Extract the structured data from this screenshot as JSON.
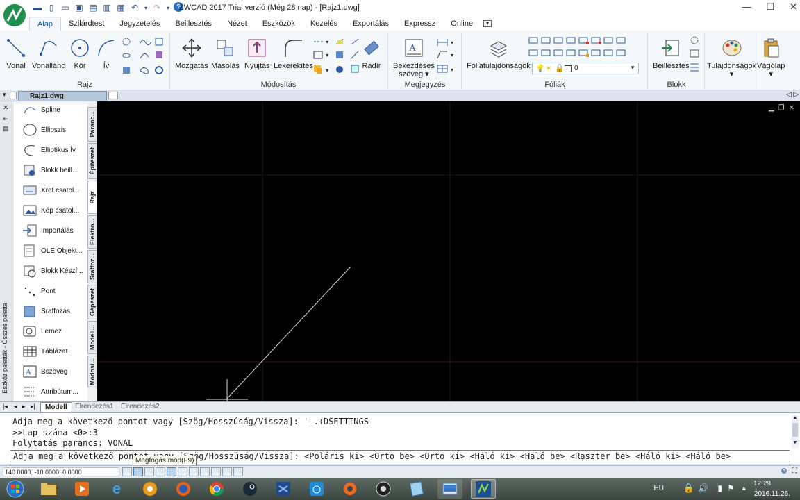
{
  "titlebar": {
    "title": "ZWCAD 2017 Trial verzió  (Még 28 nap) - [Rajz1.dwg]",
    "minimize": "—",
    "maximize": "☐",
    "close": "✕"
  },
  "ribbon_tabs": [
    "Alap",
    "Szilárdtest",
    "Jegyzetelés",
    "Beillesztés",
    "Nézet",
    "Eszközök",
    "Kezelés",
    "Exportálás",
    "Expressz",
    "Online"
  ],
  "ribbon": {
    "draw": {
      "vonal": "Vonal",
      "vonallanc": "Vonallánc",
      "kor": "Kör",
      "iv": "Ív",
      "group": "Rajz"
    },
    "modify": {
      "mozgatas": "Mozgatás",
      "masolas": "Másolás",
      "nyujtas": "Nyújtás",
      "lekerekites": "Lekerekítés",
      "radir": "Radír",
      "group": "Módosítás"
    },
    "annotation": {
      "bekezdeses_line1": "Bekezdéses",
      "bekezdeses_line2": "szöveg",
      "group": "Megjegyzés"
    },
    "layers": {
      "foliatulajdonsagok": "Fóliatulajdonságok",
      "current_layer": "0",
      "group": "Fóliák"
    },
    "block": {
      "beillesztes": "Beillesztés",
      "group": "Blokk"
    },
    "tulajdonsagok": "Tulajdonságok",
    "vagolap": "Vágólap"
  },
  "document_tab": "Rajz1.dwg",
  "palette": {
    "title": "Eszköz paletták - Összes paletta",
    "items": [
      "Spline",
      "Ellipszis",
      "Elliptikus Ív",
      "Blokk beill...",
      "Xref csatol...",
      "Kép csatol...",
      "Importálás",
      "OLE Objekt...",
      "Blokk Készí...",
      "Pont",
      "Sraffozás",
      "Lemez",
      "Táblázat",
      "Bszöveg",
      "Attribútum..."
    ],
    "tabs": [
      "Paranc...",
      "Építészet",
      "Rajz",
      "Elektro...",
      "Sraffoz...",
      "Gépészet",
      "Modell...",
      "Módosí..."
    ]
  },
  "layout_tabs": [
    "Modell",
    "Elrendezés1",
    "Elrendezés2"
  ],
  "command": {
    "history": [
      "Adja meg a következő pontot vagy [Szög/Hosszúság/Vissza]: '_.+DSETTINGS",
      ">>Lap száma <0>:3",
      "Folytatás parancs: VONAL"
    ],
    "current": "Adja meg a következő pontot vagy [Szög/Hosszúság/Vissza]:  <Poláris ki>  <Orto be>  <Orto ki>  <Háló ki>  <Háló be>  <Raszter be>  <Háló ki>  <Háló be>"
  },
  "tooltip": "Megfogás mód(F9)",
  "status": {
    "coords": "140.0000, -10.0000, 0.0000"
  },
  "tray": {
    "lang": "HU",
    "time": "12:29",
    "date": "2016.11.26."
  },
  "colors": {
    "accent": "#1b5fb3",
    "canvas": "#000000",
    "taskbar": "#4a5550"
  }
}
